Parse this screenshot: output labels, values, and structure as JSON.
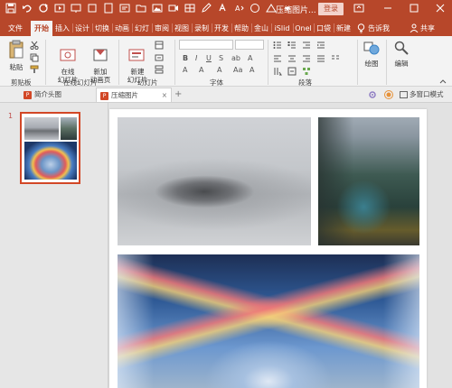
{
  "titlebar": {
    "doc_title": "压缩图片...",
    "login_label": "登录",
    "color": "#b7472a"
  },
  "tabs": [
    {
      "label": "文件",
      "active": false
    },
    {
      "label": "开始",
      "active": true
    },
    {
      "label": "插入",
      "active": false
    },
    {
      "label": "设计",
      "active": false
    },
    {
      "label": "切换",
      "active": false
    },
    {
      "label": "动画",
      "active": false
    },
    {
      "label": "幻灯",
      "active": false
    },
    {
      "label": "审阅",
      "active": false
    },
    {
      "label": "视图",
      "active": false
    },
    {
      "label": "录制",
      "active": false
    },
    {
      "label": "开发",
      "active": false
    },
    {
      "label": "帮助",
      "active": false
    },
    {
      "label": "金山",
      "active": false
    },
    {
      "label": "iSlid",
      "active": false
    },
    {
      "label": "Onel",
      "active": false
    },
    {
      "label": "口袋",
      "active": false
    },
    {
      "label": "新建",
      "active": false
    }
  ],
  "tell_me": "告诉我",
  "share_label": "共享",
  "ribbon": {
    "paste_label": "粘贴",
    "clipboard_group": "剪贴板",
    "online_slides_label": "在线\n幻灯片",
    "new_animation_label": "新加\n动画页",
    "online_slides_group": "在线幻灯片",
    "new_slide_label": "新建\n幻灯片",
    "slides_group": "幻灯片",
    "font_group": "字体",
    "paragraph_group": "段落",
    "drawing_label": "绘图",
    "editing_label": "编辑"
  },
  "doctabs": {
    "tab1": "简介头图",
    "tab2": "压缩图片",
    "multi_window": "多窗口模式"
  },
  "slides": {
    "current_number": "1"
  }
}
